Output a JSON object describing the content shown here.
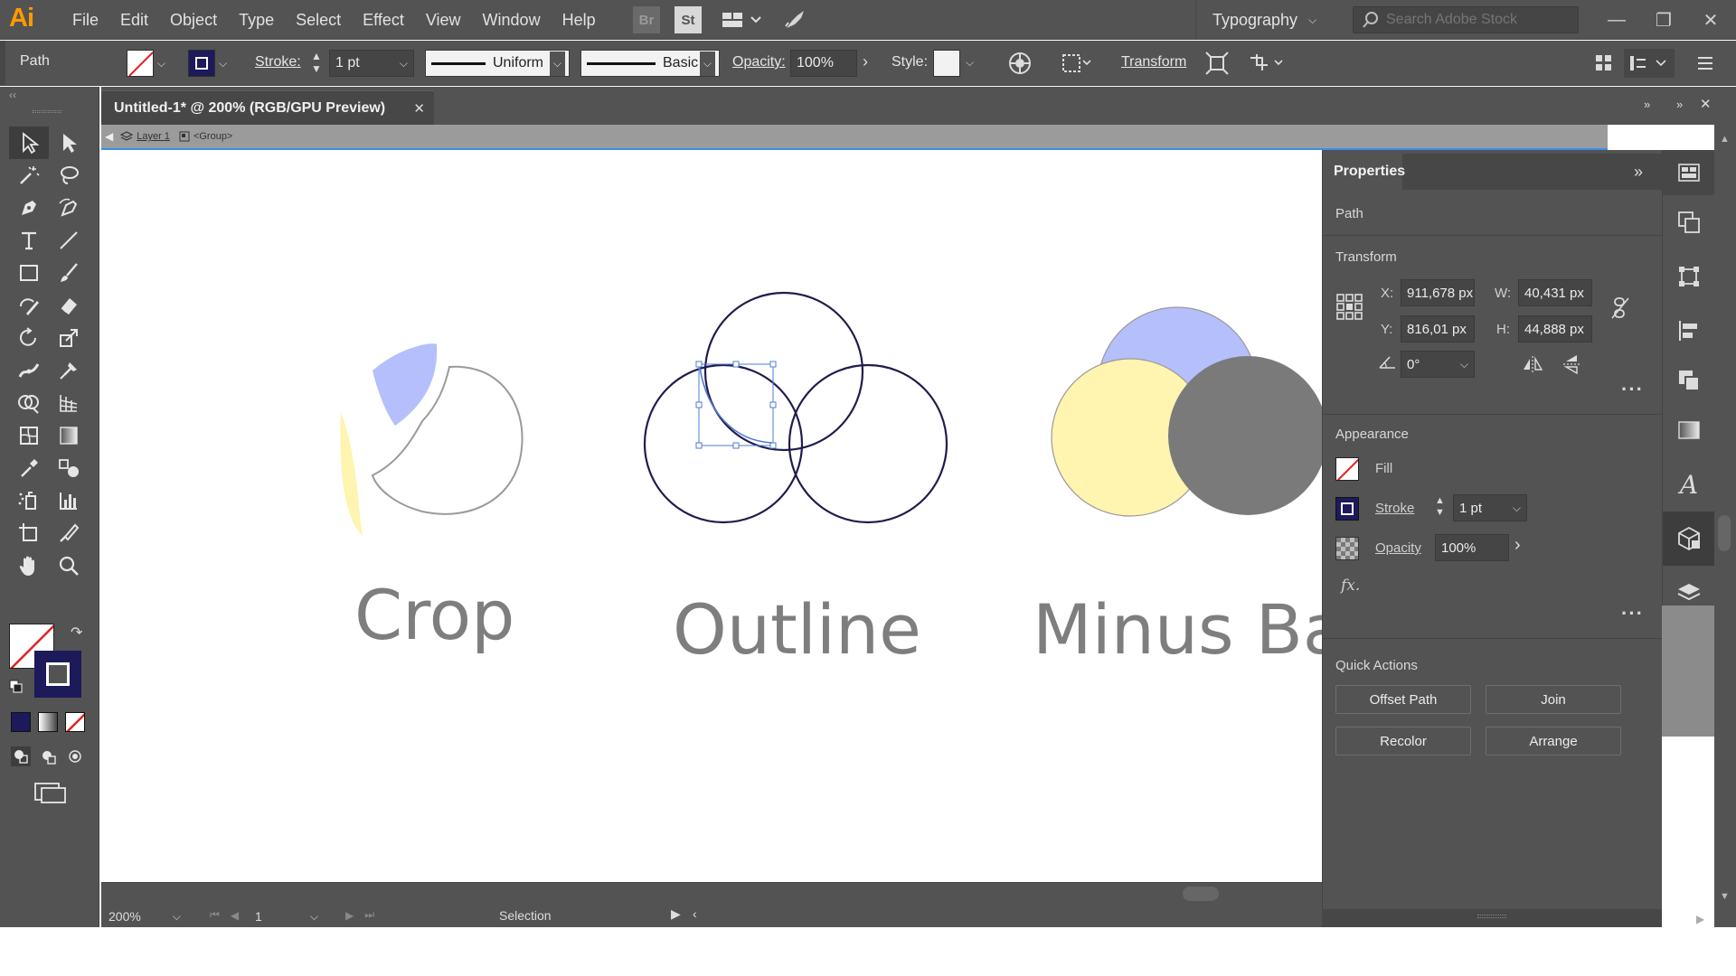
{
  "app": {
    "logo": "Ai"
  },
  "menu": [
    "File",
    "Edit",
    "Object",
    "Type",
    "Select",
    "Effect",
    "View",
    "Window",
    "Help"
  ],
  "menubar_icons": {
    "bridge": "Br",
    "stock": "St"
  },
  "workspace": "Typography",
  "search": {
    "placeholder": "Search Adobe Stock"
  },
  "control_bar": {
    "selection_type": "Path",
    "stroke_label": "Stroke:",
    "stroke_weight": "1 pt",
    "profile": "Uniform",
    "brush": "Basic",
    "opacity_label": "Opacity:",
    "opacity": "100%",
    "style_label": "Style:",
    "transform_link": "Transform"
  },
  "document": {
    "tab_title": "Untitled-1* @ 200% (RGB/GPU Preview)",
    "breadcrumb_layer": "Layer 1",
    "breadcrumb_group": "<Group>"
  },
  "canvas": {
    "labels": {
      "crop": "Crop",
      "outline": "Outline",
      "minus_back": "Minus Ba"
    },
    "colors": {
      "yellow": "#fff4b0",
      "blue": "#b5bffb",
      "grey": "#7a7a7a",
      "navy": "#1f1c4e",
      "ring_grey": "#9a9a9a"
    }
  },
  "status": {
    "zoom": "200%",
    "artboard": "1",
    "tool": "Selection"
  },
  "properties": {
    "tab": "Properties",
    "object_type": "Path",
    "transform": {
      "title": "Transform",
      "x_label": "X:",
      "x": "911,678 px",
      "y_label": "Y:",
      "y": "816,01 px",
      "w_label": "W:",
      "w": "40,431 px",
      "h_label": "H:",
      "h": "44,888 px",
      "angle": "0°"
    },
    "appearance": {
      "title": "Appearance",
      "fill_label": "Fill",
      "stroke_label": "Stroke",
      "stroke_value": "1 pt",
      "opacity_label": "Opacity",
      "opacity_value": "100%",
      "fx_label": "fx."
    },
    "quick_actions": {
      "title": "Quick Actions",
      "buttons": [
        "Offset Path",
        "Join",
        "Recolor",
        "Arrange"
      ]
    }
  }
}
